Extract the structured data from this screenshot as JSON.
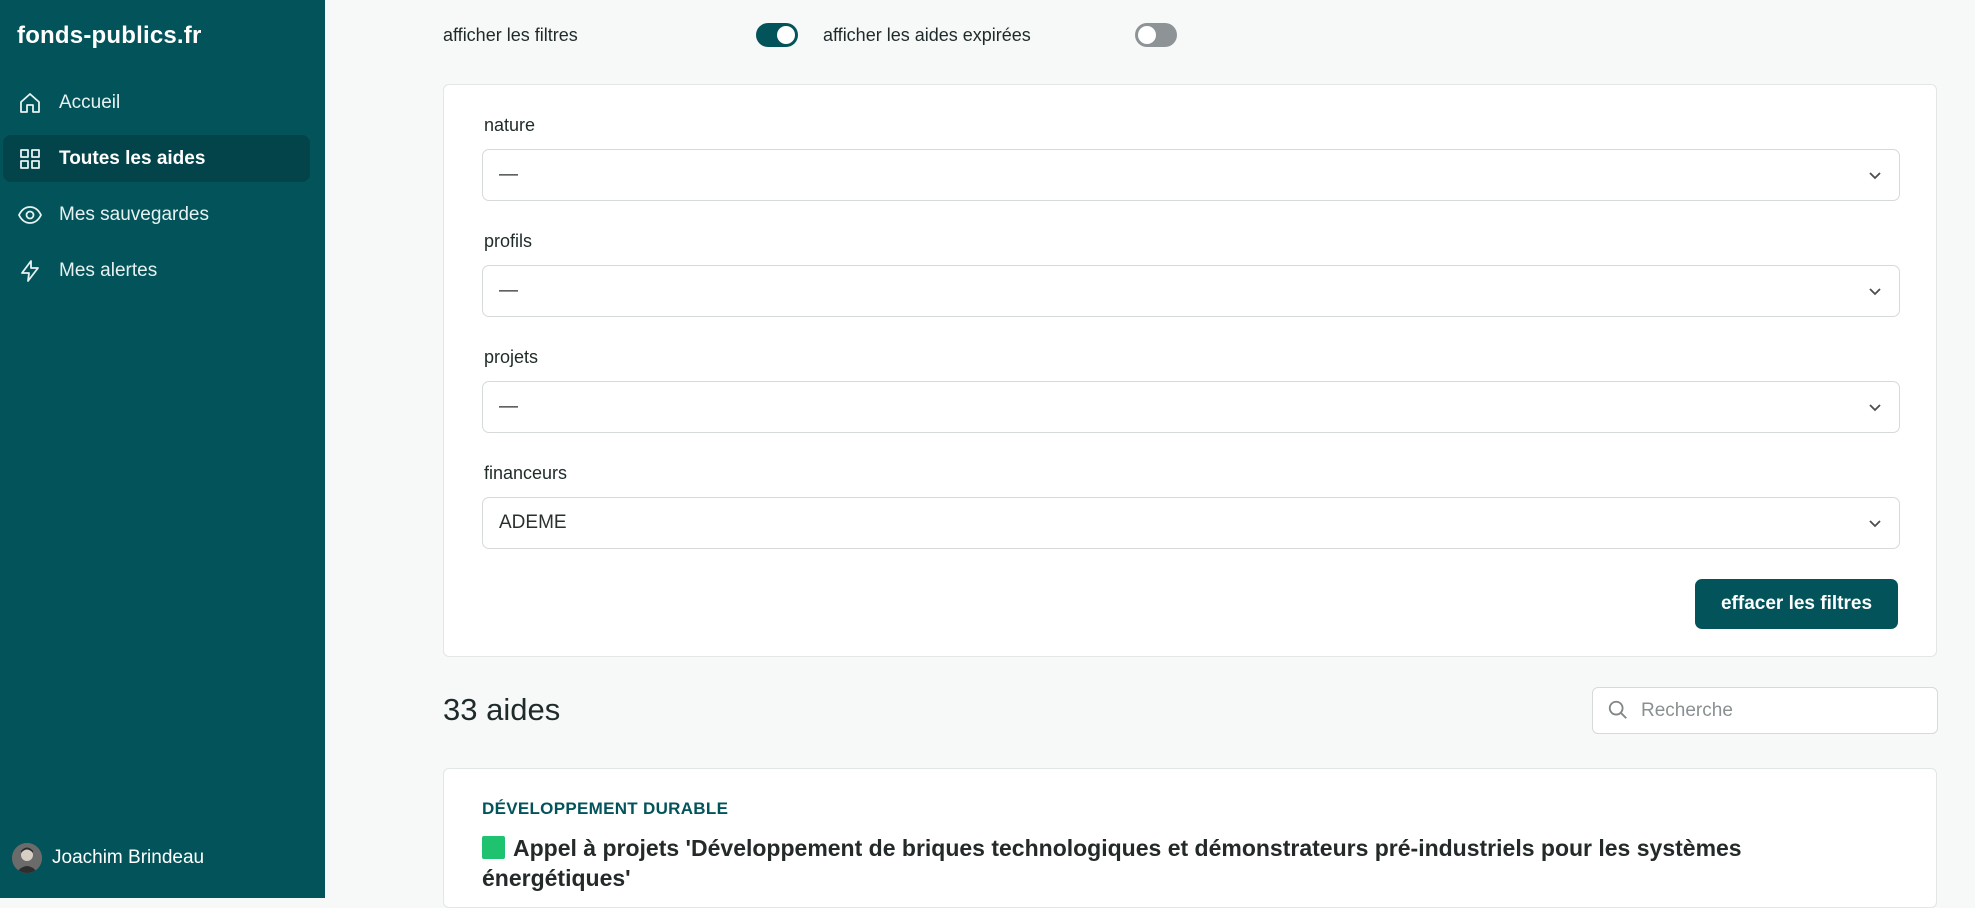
{
  "sidebar": {
    "logo": "fonds-publics.fr",
    "items": [
      {
        "label": "Accueil",
        "icon": "home-icon"
      },
      {
        "label": "Toutes les aides",
        "icon": "grid-icon",
        "active": true
      },
      {
        "label": "Mes sauvegardes",
        "icon": "eye-icon"
      },
      {
        "label": "Mes alertes",
        "icon": "lightning-icon"
      }
    ],
    "user": {
      "name": "Joachim Brindeau"
    }
  },
  "toggles": {
    "show_filters": {
      "label": "afficher les filtres",
      "on": true
    },
    "show_expired": {
      "label": "afficher les aides expirées",
      "on": false
    }
  },
  "filters": {
    "nature": {
      "label": "nature",
      "value": "—"
    },
    "profils": {
      "label": "profils",
      "value": "—"
    },
    "projets": {
      "label": "projets",
      "value": "—"
    },
    "financeurs": {
      "label": "financeurs",
      "value": "ADEME"
    },
    "clear_label": "effacer les filtres"
  },
  "results": {
    "count_label": "33 aides",
    "search_placeholder": "Recherche",
    "items": [
      {
        "tag": "DÉVELOPPEMENT DURABLE",
        "title": "Appel à projets 'Développement de briques technologiques et démonstrateurs pré-industriels pour les systèmes énergétiques'"
      }
    ]
  },
  "colors": {
    "brand": "#03545a",
    "brand_dark": "#024449",
    "status_green": "#1ec26f",
    "toggle_off": "#8e9496"
  }
}
